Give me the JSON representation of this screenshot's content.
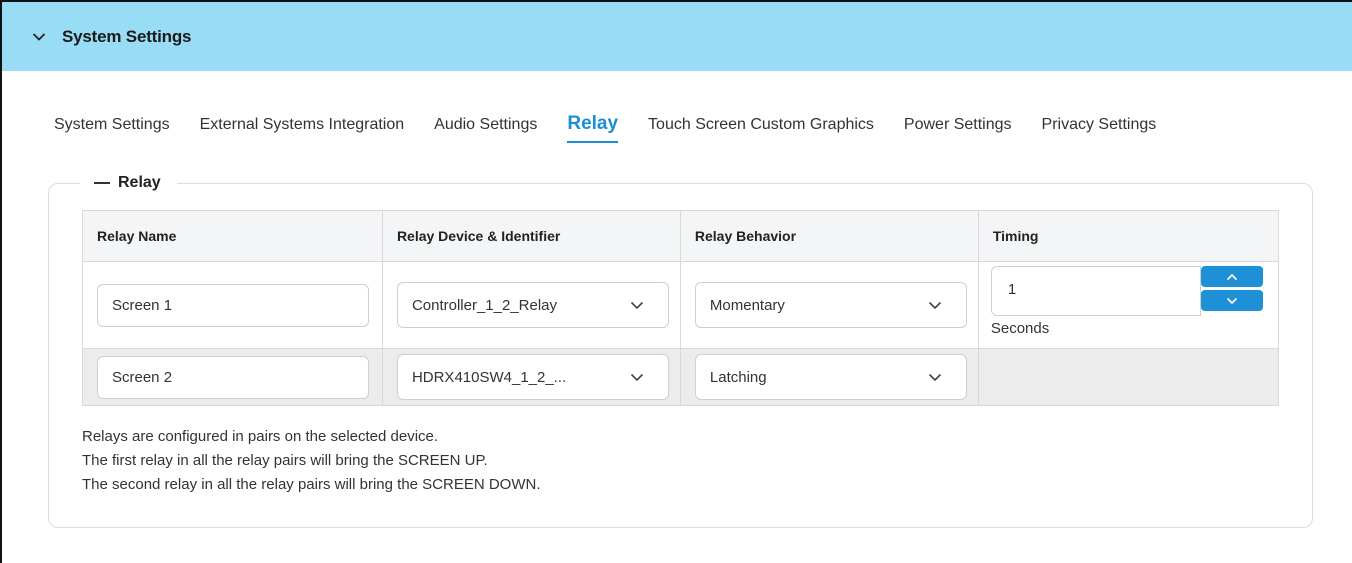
{
  "header": {
    "title": "System Settings",
    "collapse_icon": "chevron-down-icon",
    "background": "#99dcf5"
  },
  "tabs": [
    {
      "label": "System Settings",
      "active": false
    },
    {
      "label": "External Systems Integration",
      "active": false
    },
    {
      "label": "Audio Settings",
      "active": false
    },
    {
      "label": "Relay",
      "active": true
    },
    {
      "label": "Touch Screen Custom Graphics",
      "active": false
    },
    {
      "label": "Power Settings",
      "active": false
    },
    {
      "label": "Privacy Settings",
      "active": false
    }
  ],
  "accent_color": "#1a8fd8",
  "section": {
    "title": "Relay"
  },
  "table": {
    "headers": [
      "Relay Name",
      "Relay Device & Identifier",
      "Relay Behavior",
      "Timing"
    ],
    "rows": [
      {
        "name": "Screen 1",
        "device": "Controller_1_2_Relay",
        "behavior": "Momentary",
        "timing_value": "1",
        "timing_units": "Seconds"
      },
      {
        "name": "Screen 2",
        "device": "HDRX410SW4_1_2_...",
        "behavior": "Latching"
      }
    ]
  },
  "notes": [
    "Relays are configured in pairs on the selected device.",
    "The first relay in all the relay pairs will bring the SCREEN UP.",
    "The second relay in all the relay pairs will bring the SCREEN DOWN."
  ]
}
